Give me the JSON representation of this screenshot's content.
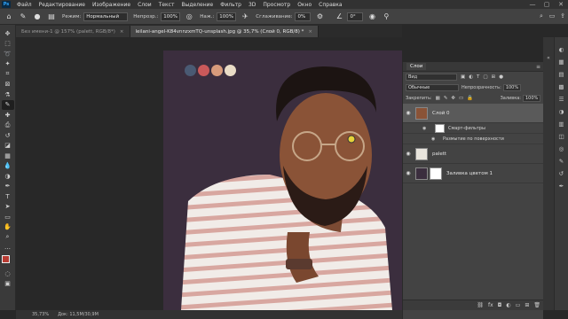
{
  "menubar": {
    "logo": "Ps",
    "items": [
      "Файл",
      "Редактирование",
      "Изображение",
      "Слои",
      "Текст",
      "Выделение",
      "Фильтр",
      "3D",
      "Просмотр",
      "Окно",
      "Справка"
    ],
    "window_controls": [
      "—",
      "▢",
      "✕"
    ]
  },
  "options": {
    "mode_label": "Режим:",
    "mode_value": "Нормальный",
    "opacity_label": "Непрозр.:",
    "opacity_value": "100%",
    "pressure_label": "Наж.:",
    "pressure_value": "100%",
    "smoothing_label": "Сглаживание:",
    "smoothing_value": "0%",
    "angle_value": "0°"
  },
  "tabs": [
    {
      "label": "Без имени-1 @ 157% (palett, RGB/8*)",
      "close": "×",
      "active": false
    },
    {
      "label": "leilani-angel-K84vnnzxmTQ-unsplash.jpg @ 35,7% (Слой 0, RGB/8) *",
      "close": "×",
      "active": true
    }
  ],
  "tools": [
    "move-icon",
    "marquee-icon",
    "lasso-icon",
    "quick-select-icon",
    "crop-icon",
    "frame-icon",
    "eyedropper-icon",
    "healing-icon",
    "brush-icon",
    "stamp-icon",
    "history-brush-icon",
    "eraser-icon",
    "gradient-icon",
    "blur-icon",
    "dodge-icon",
    "pen-icon",
    "type-icon",
    "path-select-icon",
    "shape-icon",
    "hand-icon",
    "zoom-icon",
    "more-icon"
  ],
  "colors": {
    "foreground": "#b83b32",
    "background": "#ffffff",
    "swatches": [
      "#4a5a73",
      "#c9595a",
      "#d79b7b",
      "#e9dcc6"
    ],
    "document_bg": "#3b2e3e"
  },
  "layers_panel": {
    "title": "Слои",
    "filter_label": "Вид",
    "blend_mode": "Обычные",
    "opacity_label": "Непрозрачность:",
    "opacity_value": "100%",
    "lock_label": "Закрепить:",
    "fill_label": "Заливка:",
    "fill_value": "100%",
    "layers": [
      {
        "name": "Слой 0",
        "selected": true
      },
      {
        "name": "Смарт-фильтры",
        "sub": true
      },
      {
        "name": "Размытие по поверхности",
        "sub": true
      },
      {
        "name": "palett",
        "selected": false
      },
      {
        "name": "Заливка цветом 1",
        "selected": false
      }
    ]
  },
  "status": {
    "zoom": "35,73%",
    "doc": "Док: 11,5M/30,9M"
  }
}
